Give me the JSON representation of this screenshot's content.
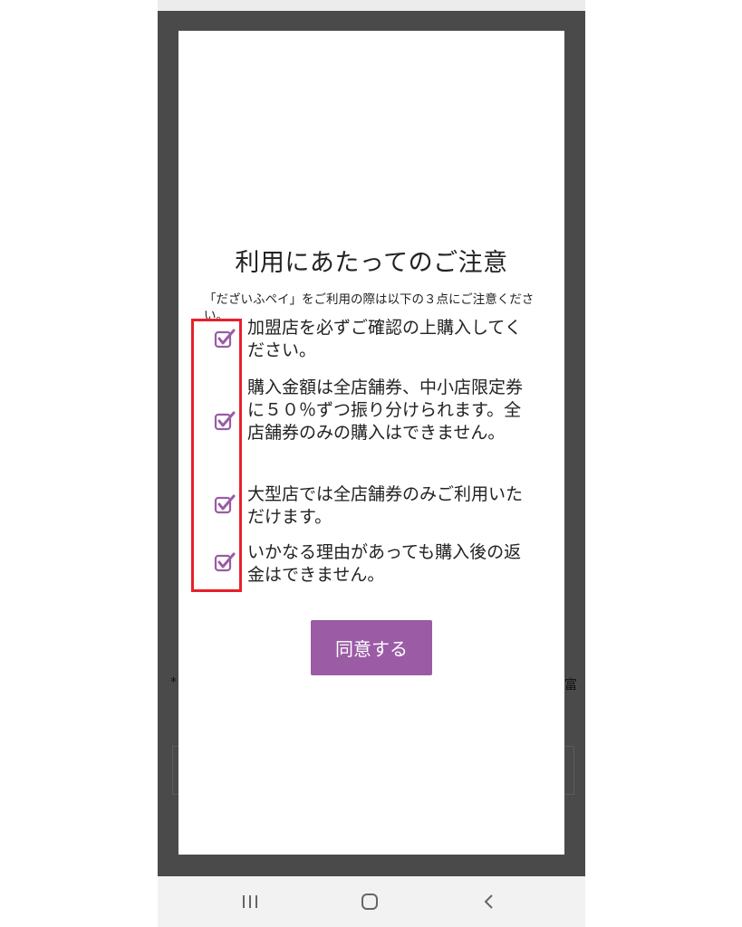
{
  "dialog": {
    "title": "利用にあたってのご注意",
    "intro": "「だざいふペイ」をご利用の際は以下の３点にご注意ください。",
    "items": [
      "加盟店を必ずご確認の上購入してください。",
      "購入金額は全店舗券、中小店限定券に５０％ずつ振り分けられます。全店舗券のみの購入はできません。",
      "大型店では全店舗券のみご利用いただけます。",
      "いかなる理由があっても購入後の返金はできません。"
    ],
    "agree_label": "同意する"
  },
  "background": {
    "left_hint": "*",
    "right_hint": "富"
  },
  "navbar": {
    "recents_icon": "recents-icon",
    "home_icon": "home-icon",
    "back_icon": "back-icon"
  },
  "colors": {
    "accent": "#9b5ba5",
    "highlight": "#e8202a",
    "overlay": "#4a4a4a"
  }
}
